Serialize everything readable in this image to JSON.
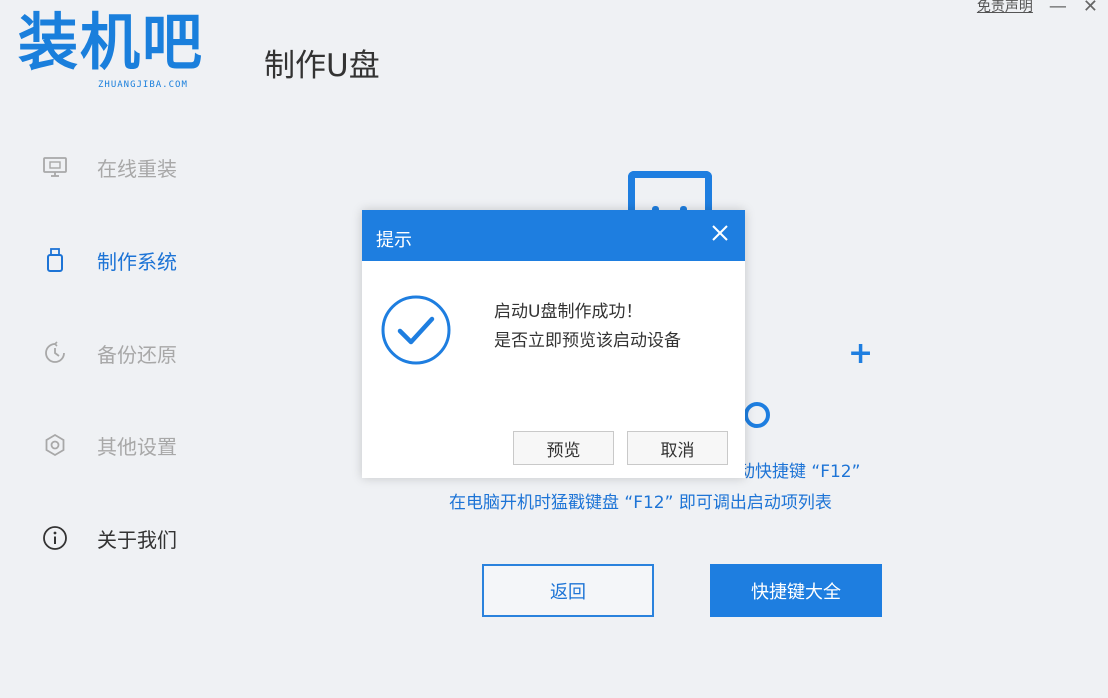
{
  "header": {
    "logo_text": "装机吧",
    "logo_sub": "ZHUANGJIBA.COM",
    "page_title": "制作U盘",
    "disclaimer_label": "免责声明",
    "minimize_glyph": "—",
    "close_glyph": "✕"
  },
  "sidebar": {
    "items": [
      {
        "label": "在线重装",
        "icon": "monitor-icon",
        "state": "inactive"
      },
      {
        "label": "制作系统",
        "icon": "usb-drive-icon",
        "state": "active"
      },
      {
        "label": "备份还原",
        "icon": "backup-icon",
        "state": "inactive"
      },
      {
        "label": "其他设置",
        "icon": "gear-icon",
        "state": "inactive"
      },
      {
        "label": "关于我们",
        "icon": "info-icon",
        "state": "normal"
      }
    ]
  },
  "main": {
    "hint_line1": "动快捷键 “F12”",
    "hint_line2": "在电脑开机时猛戳键盘 “F12” 即可调出启动项列表",
    "back_button": "返回",
    "hotkeys_button": "快捷键大全"
  },
  "dialog": {
    "title": "提示",
    "message_line1": "启动U盘制作成功！",
    "message_line2": "是否立即预览该启动设备",
    "preview_button": "预览",
    "cancel_button": "取消",
    "icon": "check-circle-icon"
  },
  "colors": {
    "accent": "#1e7ee0",
    "background": "#eff1f4",
    "inactive_text": "#a8a8a8"
  }
}
